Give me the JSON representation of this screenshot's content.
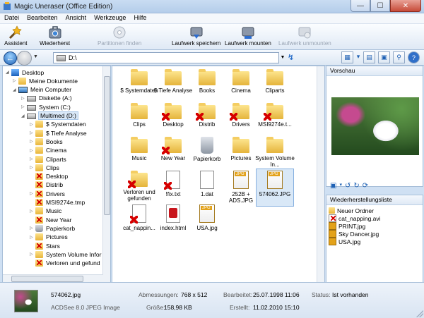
{
  "window": {
    "title": "Magic Uneraser (Office Edition)",
    "controls": {
      "minimize": "—",
      "maximize": "☐",
      "close": "✕"
    }
  },
  "menu": [
    "Datei",
    "Bearbeiten",
    "Ansicht",
    "Werkzeuge",
    "Hilfe"
  ],
  "toolbar": {
    "assistent": "Assistent",
    "wiederherst": "Wiederherst",
    "partitionen": "Partitionen finden",
    "speichern": "Laufwerk speichern",
    "mounten": "Laufwerk mounten",
    "unmounten": "Laufwerk unmounten"
  },
  "address": {
    "value": "D:\\"
  },
  "tree": [
    {
      "label": "Desktop",
      "icon": "desktop-icon",
      "expander": "◢"
    },
    {
      "label": "Meine Dokumente",
      "icon": "folder-icon",
      "expander": "▷"
    },
    {
      "label": "Mein Computer",
      "icon": "computer-icon",
      "expander": "◢"
    },
    {
      "label": "Diskette (A:)",
      "icon": "floppy-icon",
      "expander": "▷"
    },
    {
      "label": "System (C:)",
      "icon": "drive-icon",
      "expander": "▷"
    },
    {
      "label": "Multimed (D:)",
      "icon": "drive-icon",
      "expander": "◢"
    },
    {
      "label": "$ Systemdaten",
      "icon": "folder-icon",
      "expander": "▷"
    },
    {
      "label": "$ Tiefe Analyse",
      "icon": "folder-icon",
      "expander": "▷"
    },
    {
      "label": "Books",
      "icon": "folder-icon",
      "expander": "▷"
    },
    {
      "label": "Cinema",
      "icon": "folder-icon",
      "expander": "▷"
    },
    {
      "label": "Cliparts",
      "icon": "folder-icon",
      "expander": "▷"
    },
    {
      "label": "Clips",
      "icon": "folder-icon",
      "expander": "▷"
    },
    {
      "label": "Desktop",
      "icon": "deleted-folder-icon",
      "expander": ""
    },
    {
      "label": "Distrib",
      "icon": "deleted-folder-icon",
      "expander": ""
    },
    {
      "label": "Drivers",
      "icon": "deleted-folder-icon",
      "expander": "▷"
    },
    {
      "label": "MSI9274e.tmp",
      "icon": "deleted-folder-icon",
      "expander": ""
    },
    {
      "label": "Music",
      "icon": "folder-icon",
      "expander": "▷"
    },
    {
      "label": "New Year",
      "icon": "deleted-folder-icon",
      "expander": ""
    },
    {
      "label": "Papierkorb",
      "icon": "recycle-bin-icon",
      "expander": "▷"
    },
    {
      "label": "Pictures",
      "icon": "folder-icon",
      "expander": "▷"
    },
    {
      "label": "Stars",
      "icon": "deleted-folder-icon",
      "expander": ""
    },
    {
      "label": "System Volume Infor",
      "icon": "folder-icon",
      "expander": "▷"
    },
    {
      "label": "Verloren und gefund",
      "icon": "deleted-folder-icon",
      "expander": ""
    }
  ],
  "files": [
    {
      "label": "$ Systemdaten",
      "icon": "folder"
    },
    {
      "label": "$ Tiefe Analyse",
      "icon": "folder"
    },
    {
      "label": "Books",
      "icon": "folder"
    },
    {
      "label": "Cinema",
      "icon": "folder"
    },
    {
      "label": "Cliparts",
      "icon": "folder"
    },
    {
      "label": "Clips",
      "icon": "folder"
    },
    {
      "label": "Desktop",
      "icon": "deleted-folder"
    },
    {
      "label": "Distrib",
      "icon": "deleted-folder"
    },
    {
      "label": "Drivers",
      "icon": "deleted-folder"
    },
    {
      "label": "MSI9274e.t...",
      "icon": "deleted-folder"
    },
    {
      "label": "Music",
      "icon": "folder"
    },
    {
      "label": "New Year",
      "icon": "deleted-folder"
    },
    {
      "label": "Papierkorb",
      "icon": "recycle-bin"
    },
    {
      "label": "Pictures",
      "icon": "folder"
    },
    {
      "label": "System Volume In...",
      "icon": "folder"
    },
    {
      "label": "Verloren und gefunden",
      "icon": "deleted-folder"
    },
    {
      "label": "!fix.txt",
      "icon": "deleted-doc"
    },
    {
      "label": "1.dat",
      "icon": "doc"
    },
    {
      "label": "252B + ADS.JPG",
      "icon": "jpg"
    },
    {
      "label": "574062.JPG",
      "icon": "jpg",
      "selected": true
    },
    {
      "label": "cat_nappin...",
      "icon": "deleted-doc"
    },
    {
      "label": "index.html",
      "icon": "html"
    },
    {
      "label": "USA.jpg",
      "icon": "jpg"
    }
  ],
  "preview": {
    "title": "Vorschau"
  },
  "restore_list": {
    "title": "Wiederherstellungsliste",
    "items": [
      "Neuer Ordner",
      "cat_napping.avi",
      "PRINT.jpg",
      "Sky Dancer.jpg",
      "USA.jpg"
    ]
  },
  "status": {
    "filename": "574062.jpg",
    "filetype": "ACDSee 8.0 JPEG Image",
    "dimensions_label": "Abmessungen:",
    "dimensions_value": "768 x 512",
    "size_label": "Größe:",
    "size_value": "158,98 KB",
    "modified_label": "Bearbeitet:",
    "modified_value": "25.07.1998 11:06",
    "created_label": "Erstellt:",
    "created_value": "11.02.2010 15:10",
    "status_label": "Status:",
    "status_value": "Ist vorhanden"
  },
  "colors": {
    "selection": "#d9e8f7",
    "deleted_mark": "#d60000",
    "folder": "#f4cd62"
  }
}
